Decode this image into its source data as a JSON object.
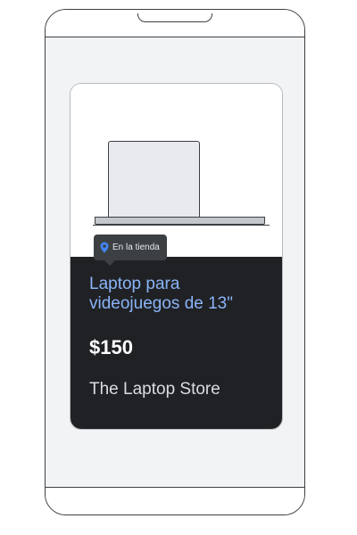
{
  "product_card": {
    "badge": {
      "icon": "location-pin-icon",
      "label": "En la tienda",
      "icon_color": "#4285f4"
    },
    "title": "Laptop para videojuegos de 13\"",
    "price": "$150",
    "store": "The Laptop Store",
    "image": "laptop-illustration",
    "colors": {
      "title": "#8ab4f8",
      "card_dark": "#202124",
      "screen_background": "#f1f3f4"
    }
  }
}
